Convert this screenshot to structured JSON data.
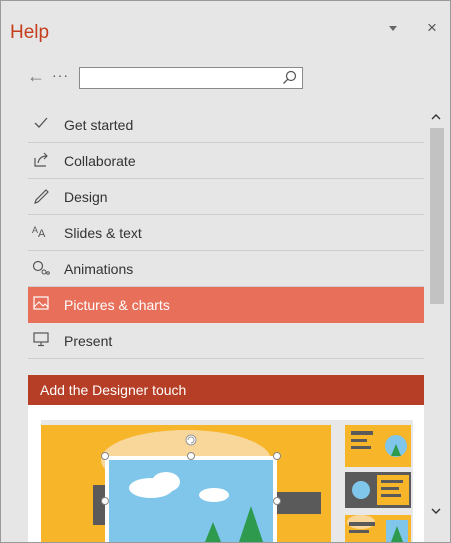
{
  "pane": {
    "title": "Help",
    "dropdown_icon": "triangle-down-icon",
    "close_label": "×"
  },
  "nav": {
    "back_label": "←",
    "more_label": "···",
    "search_value": "",
    "search_placeholder": ""
  },
  "topics": [
    {
      "label": "Get started",
      "icon": "checkmark-icon"
    },
    {
      "label": "Collaborate",
      "icon": "share-icon"
    },
    {
      "label": "Design",
      "icon": "pen-icon"
    },
    {
      "label": "Slides & text",
      "icon": "font-size-icon"
    },
    {
      "label": "Animations",
      "icon": "animation-icon"
    },
    {
      "label": "Pictures & charts",
      "icon": "picture-icon",
      "active": true
    },
    {
      "label": "Present",
      "icon": "monitor-icon"
    }
  ],
  "card": {
    "title": "Add the Designer touch"
  },
  "colors": {
    "accent": "#c43e1c",
    "active_item": "#e86f5a",
    "card_header": "#b63e26",
    "illustration_orange": "#f7b52a",
    "illustration_sky": "#7fc6ea"
  }
}
